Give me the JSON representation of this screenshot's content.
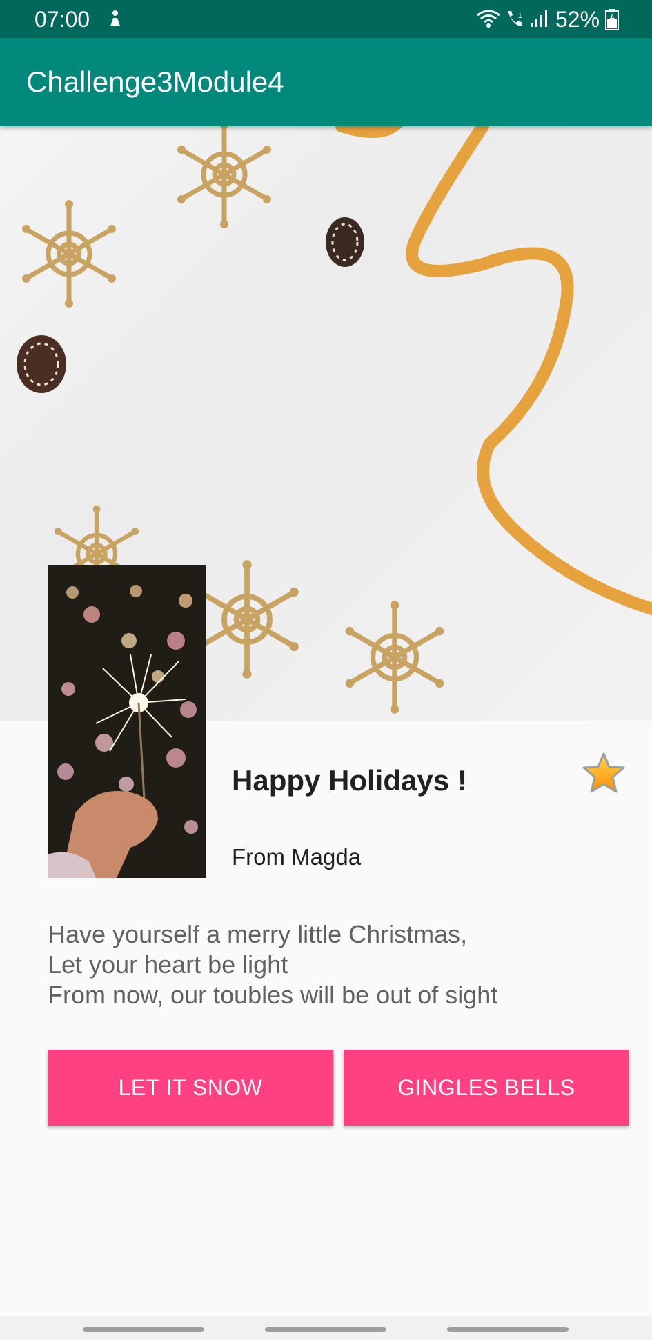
{
  "status_bar": {
    "time": "07:00",
    "battery": "52%",
    "icons": [
      "person-icon",
      "wifi-icon",
      "call-icon",
      "signal-icon",
      "battery-icon"
    ]
  },
  "app_bar": {
    "title": "Challenge3Module4"
  },
  "card": {
    "title": "Happy Holidays !",
    "from": "From Magda",
    "favorite_icon": "star-icon"
  },
  "poem": {
    "lines": [
      "Have yourself a merry little Christmas,",
      "Let your heart be light",
      "From now, our toubles will be out of sight"
    ]
  },
  "buttons": {
    "left_label": "LET IT SNOW",
    "right_label": "GINGLES BELLS"
  },
  "colors": {
    "status_bar": "#00695c",
    "app_bar": "#00897b",
    "accent": "#ff4081",
    "background": "#fafafa"
  }
}
